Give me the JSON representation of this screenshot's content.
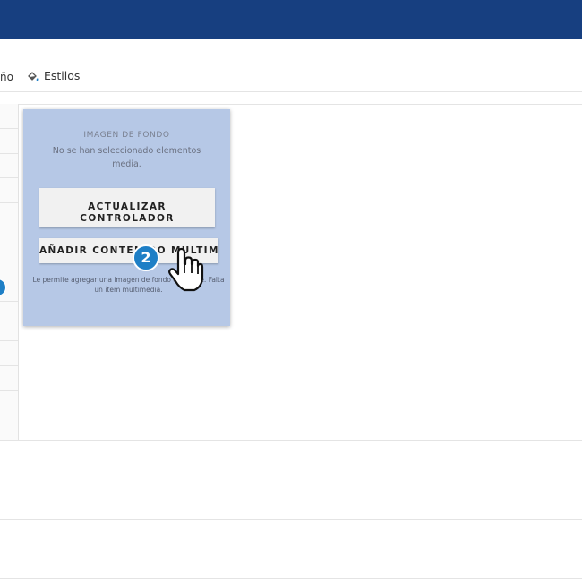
{
  "toolbar": {
    "partial_tab_label": "ño",
    "styles_label": "Estilos",
    "styles_icon": "paint-bucket-icon"
  },
  "panel": {
    "title": "IMAGEN DE FONDO",
    "message": "No se han seleccionado elementos media.",
    "update_button_label": "ACTUALIZAR CONTROLADOR",
    "add_button_label": "AÑADIR CONTENIDO MULTIM",
    "help_text": "Le permite agregar una imagen de fondo al bloque. Falta un ítem multimedia."
  },
  "overlay": {
    "step_number": "2",
    "cursor_icon": "hand-pointer-icon"
  },
  "colors": {
    "header": "#173f80",
    "panel_background": "#b6c8e6",
    "step_badge": "#1e7fc6"
  }
}
